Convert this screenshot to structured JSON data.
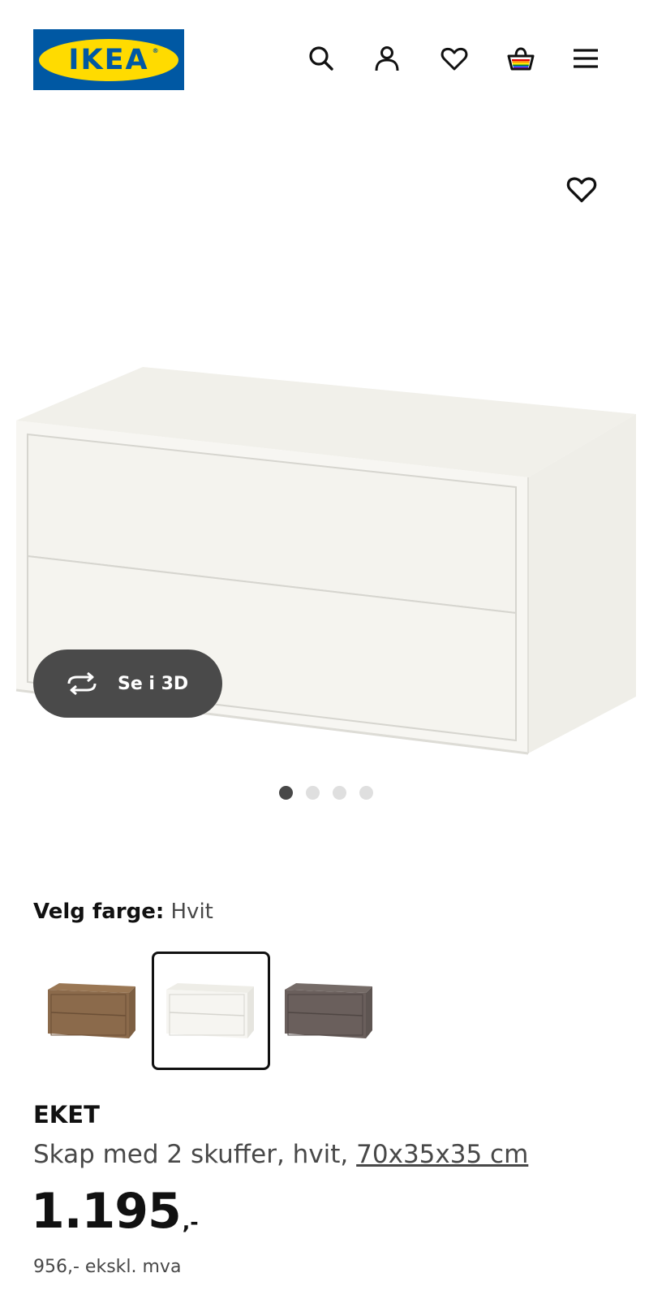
{
  "header": {
    "logo_text": "IKEA",
    "logo_registered": "®",
    "brand_colors": {
      "blue": "#0058a3",
      "yellow": "#ffdb00"
    },
    "icons": [
      "search-icon",
      "profile-icon",
      "favourites-icon",
      "shopping-bag-icon",
      "menu-icon"
    ]
  },
  "gallery": {
    "view_3d_label": "Se i 3D",
    "image_count": 4,
    "active_image": 1
  },
  "color_picker": {
    "label": "Velg farge:",
    "selected_value": "Hvit",
    "options": [
      {
        "name": "walnut",
        "color": "#8a6a4a"
      },
      {
        "name": "white",
        "color": "#f4f3ee",
        "selected": true
      },
      {
        "name": "dark-grey",
        "color": "#6a5f5c"
      }
    ]
  },
  "product": {
    "brand": "EKET",
    "description": "Skap med 2 skuffer, hvit, ",
    "dimensions": "70x35x35 cm",
    "price_integer": "1.195",
    "price_suffix": ",-",
    "price_ex_vat": "956,- ekskl. mva"
  }
}
